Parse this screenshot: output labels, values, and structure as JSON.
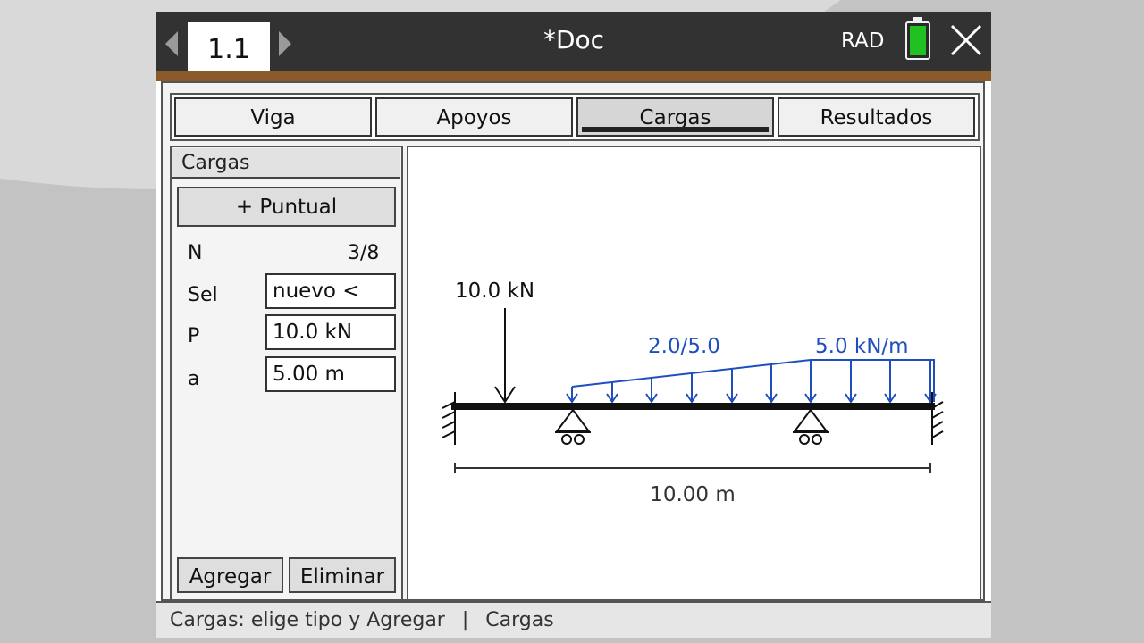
{
  "titlebar": {
    "page_tab": "1.1",
    "doc_title": "*Doc",
    "angle_mode": "RAD",
    "battery_color": "#21c121"
  },
  "tabs": [
    "Viga",
    "Apoyos",
    "Cargas",
    "Resultados"
  ],
  "active_tab": "Cargas",
  "side_panel": {
    "header": "Cargas",
    "add_type_button": "+ Puntual",
    "count_label": "N",
    "count_value": "3/8",
    "fields": [
      {
        "label": "Sel",
        "value": "nuevo <"
      },
      {
        "label": "P",
        "value": "10.0 kN"
      },
      {
        "label": "a",
        "value": "5.00 m"
      }
    ],
    "add_button": "Agregar",
    "delete_button": "Eliminar"
  },
  "diagram": {
    "point_load_label": "10.0 kN",
    "dist_load_label_1": "2.0/5.0",
    "dist_load_label_2": "5.0 kN/m",
    "span_label": "10.00 m",
    "load_color": "#1f4fbf"
  },
  "status": {
    "message": "Cargas: elige tipo y Agregar",
    "separator": "|",
    "context": "Cargas"
  }
}
